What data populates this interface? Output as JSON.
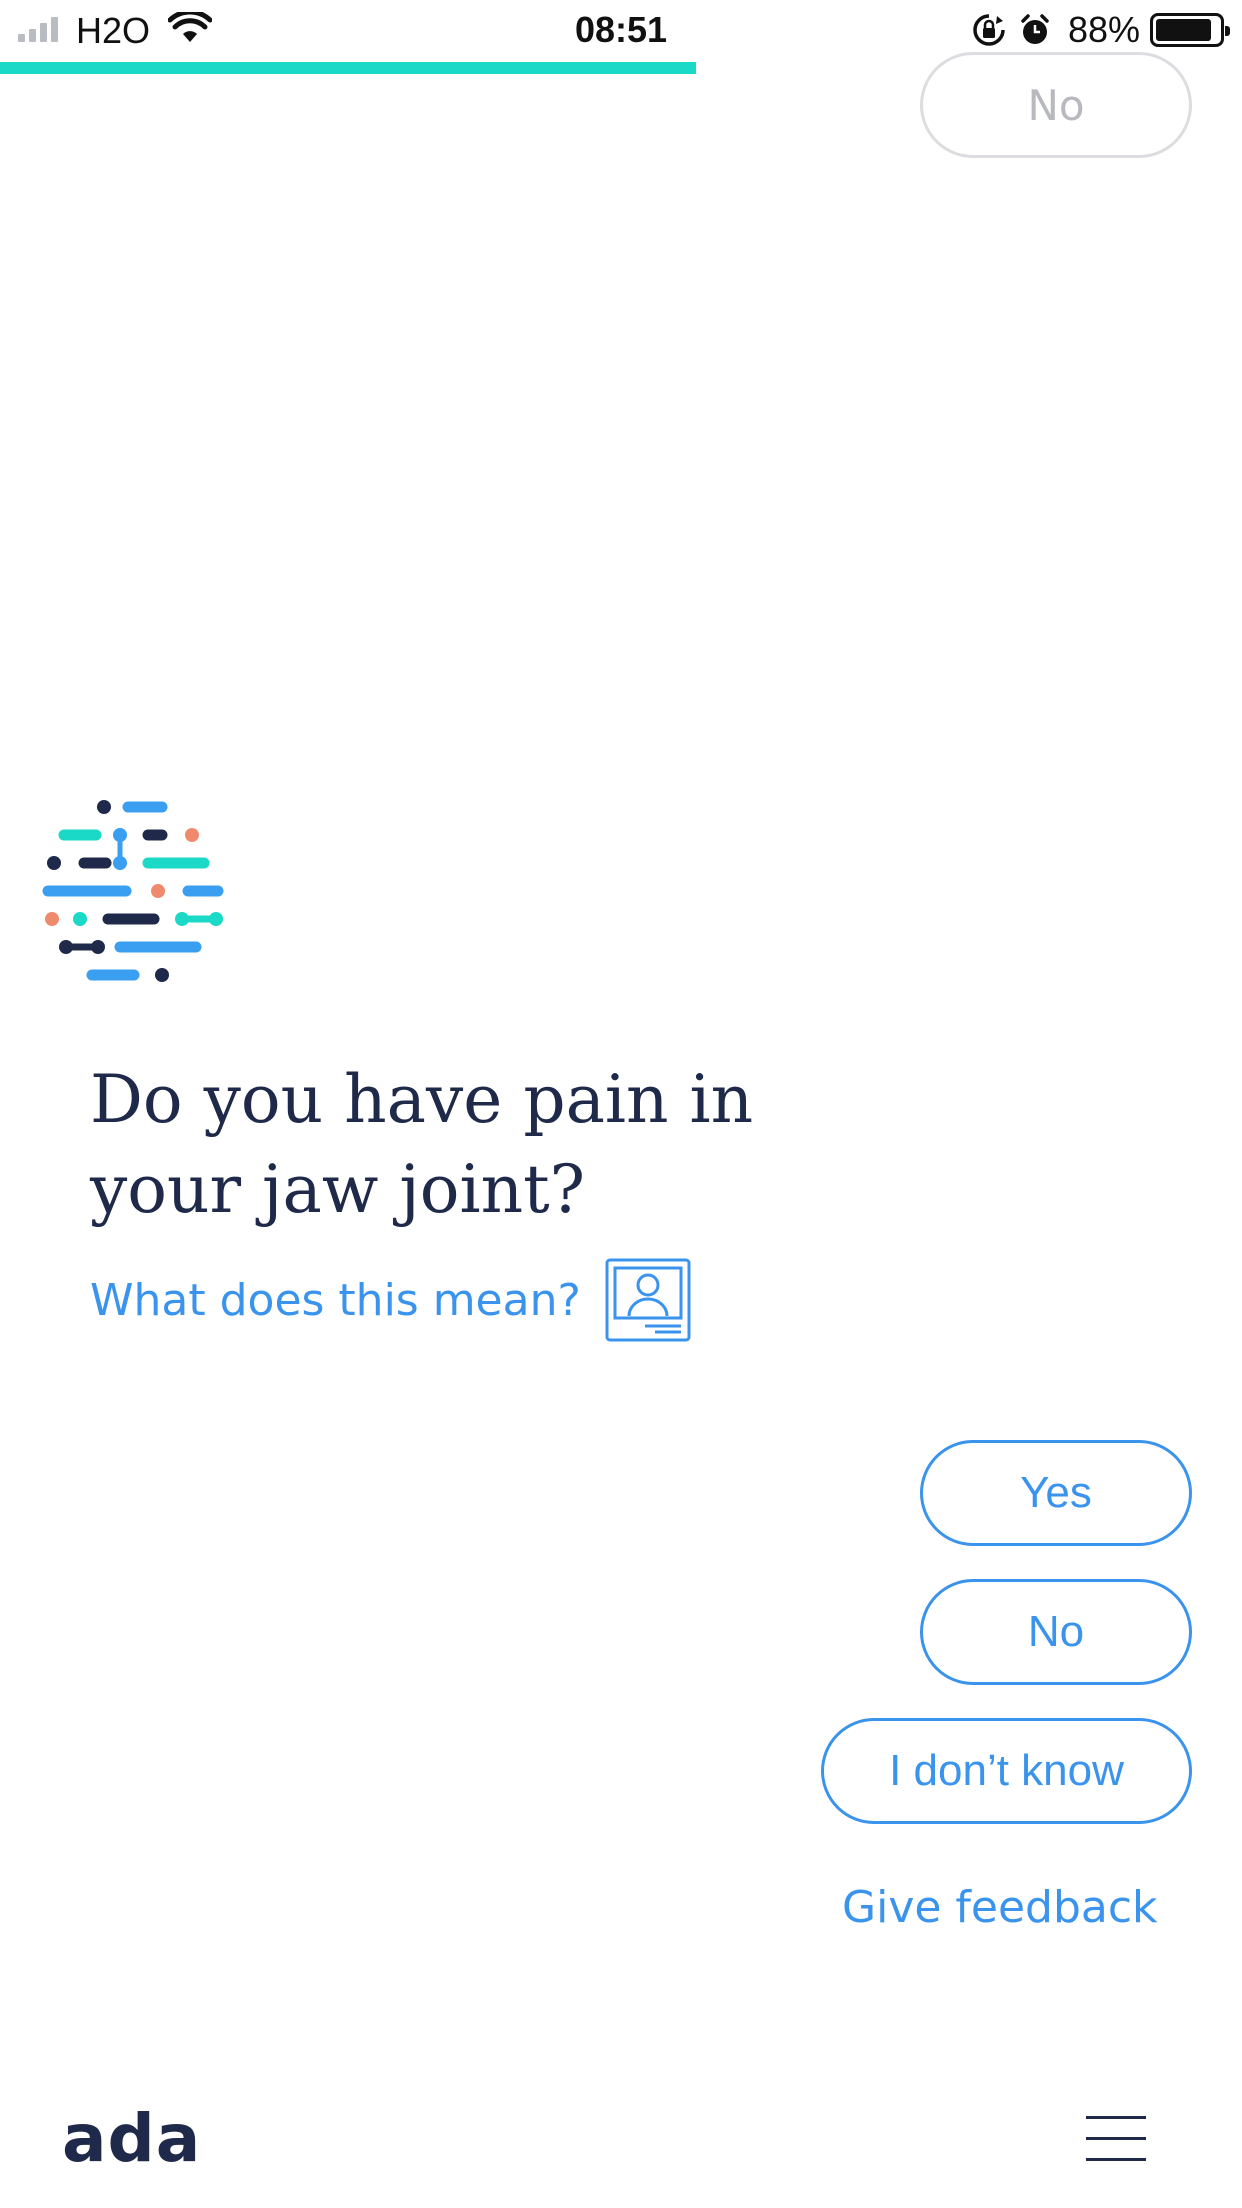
{
  "status_bar": {
    "carrier": "H2O",
    "time": "08:51",
    "battery_percent": "88%",
    "battery_level": 0.88,
    "icons": [
      "signal-icon",
      "wifi-icon",
      "rotation-lock-icon",
      "alarm-icon",
      "battery-icon"
    ]
  },
  "progress": {
    "fraction": 0.56
  },
  "previous_answer": {
    "label": "No"
  },
  "assistant": {
    "avatar_icon": "ada-avatar-icon"
  },
  "question": {
    "text": "Do you have pain in your jaw joint?",
    "explain_link": "What does this mean?",
    "explain_icon": "profile-card-icon"
  },
  "answers": [
    {
      "label": "Yes"
    },
    {
      "label": "No"
    },
    {
      "label": "I don’t know"
    }
  ],
  "feedback_link": "Give feedback",
  "footer": {
    "brand": "ada",
    "menu_icon": "hamburger-menu-icon"
  },
  "colors": {
    "accent": "#3a93ec",
    "progress": "#1ad9c7",
    "text_dark": "#1f2a4a",
    "coral": "#f08a6c"
  }
}
